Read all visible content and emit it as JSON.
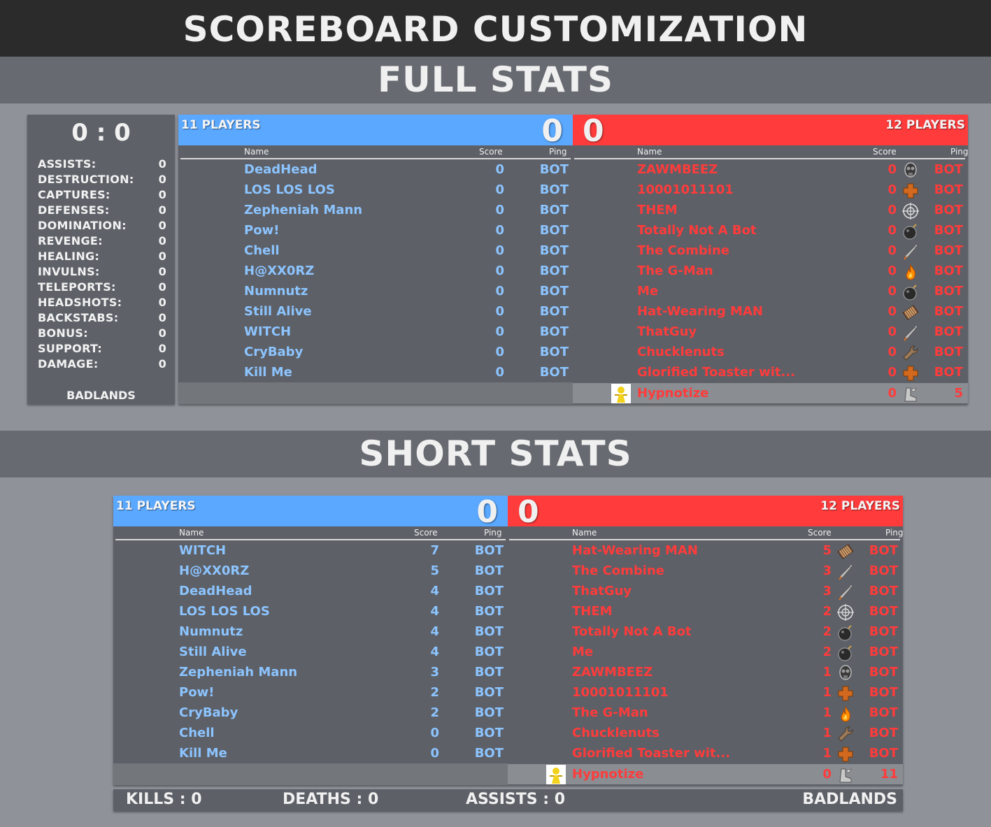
{
  "title": "SCOREBOARD CUSTOMIZATION",
  "full_title": "FULL STATS",
  "short_title": "SHORT STATS",
  "stats_panel": {
    "score": "0 : 0",
    "map": "BADLANDS",
    "stats": [
      {
        "label": "ASSISTS:",
        "value": "0"
      },
      {
        "label": "DESTRUCTION:",
        "value": "0"
      },
      {
        "label": "CAPTURES:",
        "value": "0"
      },
      {
        "label": "DEFENSES:",
        "value": "0"
      },
      {
        "label": "DOMINATION:",
        "value": "0"
      },
      {
        "label": "REVENGE:",
        "value": "0"
      },
      {
        "label": "HEALING:",
        "value": "0"
      },
      {
        "label": "INVULNS:",
        "value": "0"
      },
      {
        "label": "TELEPORTS:",
        "value": "0"
      },
      {
        "label": "HEADSHOTS:",
        "value": "0"
      },
      {
        "label": "BACKSTABS:",
        "value": "0"
      },
      {
        "label": "BONUS:",
        "value": "0"
      },
      {
        "label": "SUPPORT:",
        "value": "0"
      },
      {
        "label": "DAMAGE:",
        "value": "0"
      }
    ]
  },
  "columns": {
    "name": "Name",
    "score": "Score",
    "ping": "Ping"
  },
  "colors": {
    "blu": "#5aa8ff",
    "red": "#ff3b3b",
    "blu_text": "#8cc4ff"
  },
  "full": {
    "blu": {
      "players_label": "11 PLAYERS",
      "score": "0",
      "players": [
        {
          "name": "DeadHead",
          "score": "0",
          "ping": "BOT"
        },
        {
          "name": "LOS LOS LOS",
          "score": "0",
          "ping": "BOT"
        },
        {
          "name": "Zepheniah Mann",
          "score": "0",
          "ping": "BOT"
        },
        {
          "name": "Pow!",
          "score": "0",
          "ping": "BOT"
        },
        {
          "name": "Chell",
          "score": "0",
          "ping": "BOT"
        },
        {
          "name": "H@XX0RZ",
          "score": "0",
          "ping": "BOT"
        },
        {
          "name": "Numnutz",
          "score": "0",
          "ping": "BOT"
        },
        {
          "name": "Still Alive",
          "score": "0",
          "ping": "BOT"
        },
        {
          "name": "WITCH",
          "score": "0",
          "ping": "BOT"
        },
        {
          "name": "CryBaby",
          "score": "0",
          "ping": "BOT"
        },
        {
          "name": "Kill Me",
          "score": "0",
          "ping": "BOT"
        }
      ]
    },
    "red": {
      "players_label": "12 PLAYERS",
      "score": "0",
      "players": [
        {
          "name": "ZAWMBEEZ",
          "score": "0",
          "ping": "BOT",
          "icon": "gasmask-icon"
        },
        {
          "name": "10001011101",
          "score": "0",
          "ping": "BOT",
          "icon": "medic-cross-icon"
        },
        {
          "name": "THEM",
          "score": "0",
          "ping": "BOT",
          "icon": "crosshair-icon"
        },
        {
          "name": "Totally Not A Bot",
          "score": "0",
          "ping": "BOT",
          "icon": "bomb-icon"
        },
        {
          "name": "The Combine",
          "score": "0",
          "ping": "BOT",
          "icon": "rocket-icon"
        },
        {
          "name": "The G-Man",
          "score": "0",
          "ping": "BOT",
          "icon": "flame-icon"
        },
        {
          "name": "Me",
          "score": "0",
          "ping": "BOT",
          "icon": "bomb-icon"
        },
        {
          "name": "Hat-Wearing MAN",
          "score": "0",
          "ping": "BOT",
          "icon": "ammo-belt-icon"
        },
        {
          "name": "ThatGuy",
          "score": "0",
          "ping": "BOT",
          "icon": "rocket-icon"
        },
        {
          "name": "Chucklenuts",
          "score": "0",
          "ping": "BOT",
          "icon": "wrench-icon"
        },
        {
          "name": "Glorified Toaster wit...",
          "score": "0",
          "ping": "BOT",
          "icon": "medic-cross-icon"
        },
        {
          "name": "Hypnotize",
          "score": "0",
          "ping": "5",
          "icon": "winged-boot-icon",
          "highlight": true
        }
      ]
    }
  },
  "short": {
    "blu": {
      "players_label": "11 PLAYERS",
      "score": "0",
      "players": [
        {
          "name": "WITCH",
          "score": "7",
          "ping": "BOT"
        },
        {
          "name": "H@XX0RZ",
          "score": "5",
          "ping": "BOT"
        },
        {
          "name": "DeadHead",
          "score": "4",
          "ping": "BOT"
        },
        {
          "name": "LOS LOS LOS",
          "score": "4",
          "ping": "BOT"
        },
        {
          "name": "Numnutz",
          "score": "4",
          "ping": "BOT"
        },
        {
          "name": "Still Alive",
          "score": "4",
          "ping": "BOT"
        },
        {
          "name": "Zepheniah Mann",
          "score": "3",
          "ping": "BOT"
        },
        {
          "name": "Pow!",
          "score": "2",
          "ping": "BOT"
        },
        {
          "name": "CryBaby",
          "score": "2",
          "ping": "BOT"
        },
        {
          "name": "Chell",
          "score": "0",
          "ping": "BOT"
        },
        {
          "name": "Kill Me",
          "score": "0",
          "ping": "BOT"
        }
      ]
    },
    "red": {
      "players_label": "12 PLAYERS",
      "score": "0",
      "players": [
        {
          "name": "Hat-Wearing MAN",
          "score": "5",
          "ping": "BOT",
          "icon": "ammo-belt-icon"
        },
        {
          "name": "The Combine",
          "score": "3",
          "ping": "BOT",
          "icon": "rocket-icon"
        },
        {
          "name": "ThatGuy",
          "score": "3",
          "ping": "BOT",
          "icon": "rocket-icon"
        },
        {
          "name": "THEM",
          "score": "2",
          "ping": "BOT",
          "icon": "crosshair-icon"
        },
        {
          "name": "Totally Not A Bot",
          "score": "2",
          "ping": "BOT",
          "icon": "bomb-icon"
        },
        {
          "name": "Me",
          "score": "2",
          "ping": "BOT",
          "icon": "bomb-icon"
        },
        {
          "name": "ZAWMBEEZ",
          "score": "1",
          "ping": "BOT",
          "icon": "gasmask-icon"
        },
        {
          "name": "10001011101",
          "score": "1",
          "ping": "BOT",
          "icon": "medic-cross-icon"
        },
        {
          "name": "The G-Man",
          "score": "1",
          "ping": "BOT",
          "icon": "flame-icon"
        },
        {
          "name": "Chucklenuts",
          "score": "1",
          "ping": "BOT",
          "icon": "wrench-icon"
        },
        {
          "name": "Glorified Toaster wit...",
          "score": "1",
          "ping": "BOT",
          "icon": "medic-cross-icon"
        },
        {
          "name": "Hypnotize",
          "score": "0",
          "ping": "11",
          "icon": "winged-boot-icon",
          "highlight": true
        }
      ]
    }
  },
  "short_footer": {
    "kills": "KILLS :  0",
    "deaths": "DEATHS :  0",
    "assists": "ASSISTS :  0",
    "map": "BADLANDS"
  }
}
